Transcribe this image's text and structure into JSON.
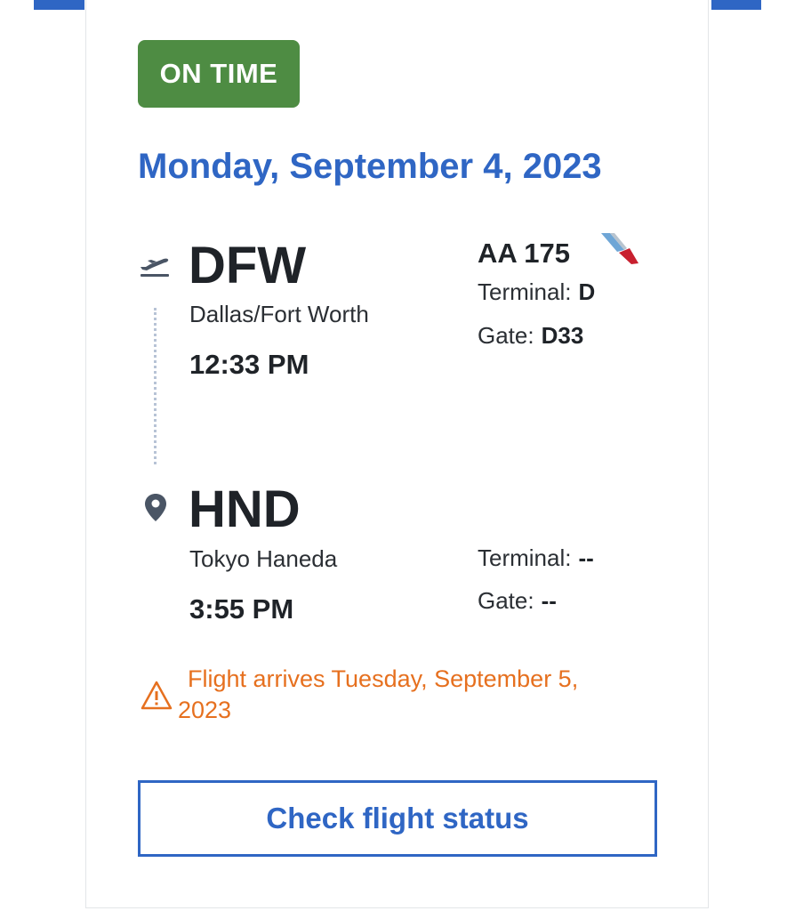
{
  "status": {
    "label": "ON TIME",
    "color": "#4e8c43"
  },
  "date": "Monday, September 4, 2023",
  "departure": {
    "code": "DFW",
    "city": "Dallas/Fort Worth",
    "time": "12:33 PM",
    "terminal_label": "Terminal:",
    "terminal": "D",
    "gate_label": "Gate:",
    "gate": "D33",
    "icon": "plane-departure-icon"
  },
  "flight": {
    "number": "AA 175",
    "airline_logo": "american-airlines-logo"
  },
  "arrival": {
    "code": "HND",
    "city": "Tokyo Haneda",
    "time": "3:55 PM",
    "terminal_label": "Terminal:",
    "terminal": "--",
    "gate_label": "Gate:",
    "gate": "--",
    "icon": "location-pin-icon"
  },
  "warning": {
    "line1": "Flight arrives Tuesday, September 5,",
    "line2": "2023",
    "icon": "warning-triangle-icon",
    "color": "#e6701f"
  },
  "button": {
    "label": "Check flight status"
  },
  "colors": {
    "accent": "#2f66c4",
    "text": "#1f2328"
  }
}
